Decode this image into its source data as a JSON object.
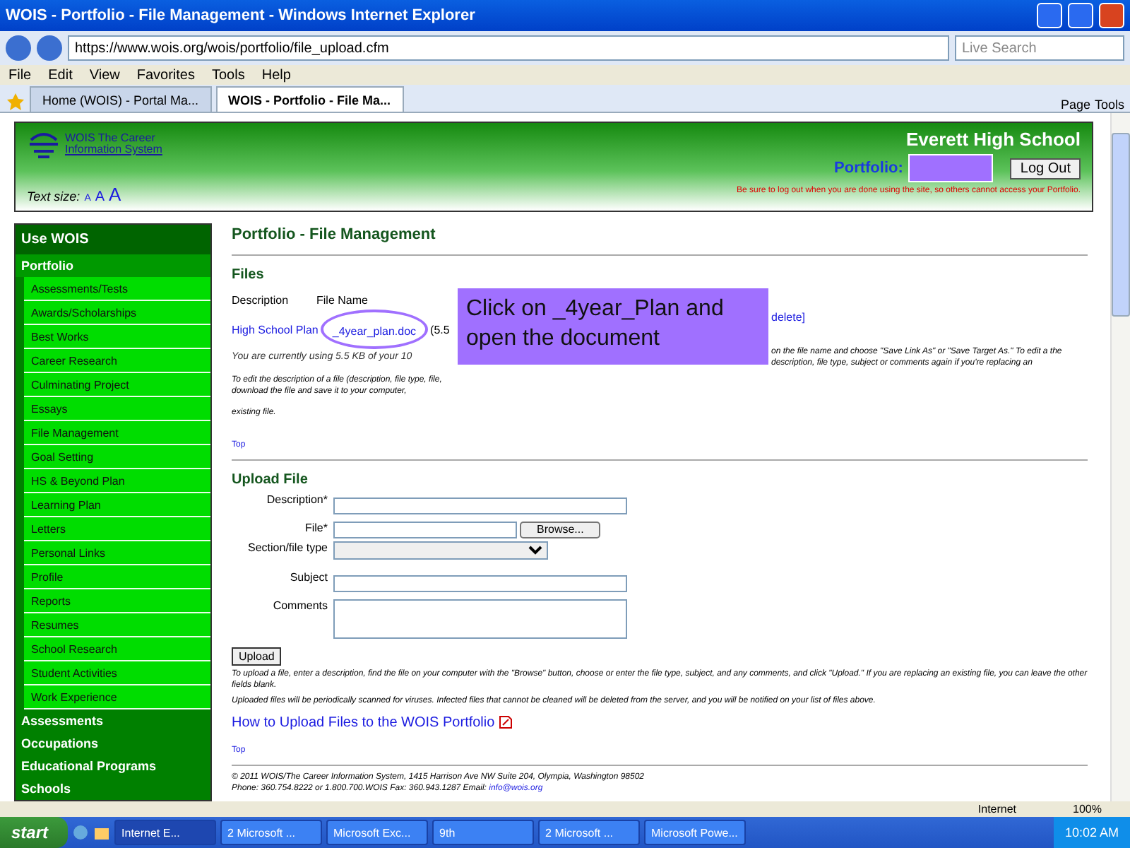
{
  "window": {
    "title": "WOIS - Portfolio - File Management - Windows Internet Explorer"
  },
  "browser": {
    "url": "https://www.wois.org/wois/portfolio/file_upload.cfm",
    "search_placeholder": "Live Search",
    "menu": [
      "File",
      "Edit",
      "View",
      "Favorites",
      "Tools",
      "Help"
    ],
    "tabs": [
      {
        "label": "Home (WOIS) - Portal Ma...",
        "selected": false
      },
      {
        "label": "WOIS - Portfolio - File Ma...",
        "selected": true
      }
    ],
    "tools": [
      "Page",
      "Tools"
    ]
  },
  "header": {
    "logo_line1": "WOIS The Career",
    "logo_line2": "Information System",
    "text_size_label": "Text size:",
    "text_sizes": [
      "A",
      "A",
      "A"
    ],
    "school": "Everett High School",
    "portfolio_label": "Portfolio:",
    "logout": "Log Out",
    "warning": "Be sure to log out when you are done using the site, so others cannot access your Portfolio."
  },
  "sidebar": {
    "heading": "Use WOIS",
    "section": "Portfolio",
    "subitems": [
      "Assessments/Tests",
      "Awards/Scholarships",
      "Best Works",
      "Career Research",
      "Culminating Project",
      "Essays",
      "File Management",
      "Goal Setting",
      "HS & Beyond Plan",
      "Learning Plan",
      "Letters",
      "Personal Links",
      "Profile",
      "Reports",
      "Resumes",
      "School Research",
      "Student Activities",
      "Work Experience"
    ],
    "items": [
      "Assessments",
      "Occupations",
      "Educational Programs",
      "Schools"
    ]
  },
  "main": {
    "title": "Portfolio - File Management",
    "files_heading": "Files",
    "columns": [
      "Description",
      "File Name"
    ],
    "row": {
      "description": "High School Plan",
      "file": "_4year_plan.doc",
      "size": "(5.5",
      "action": "delete]"
    },
    "usage": "You are currently using 5.5 KB of your 10",
    "edit_help_left": "To edit the description of a file (description, file type, file, download the file and save it to your computer,",
    "edit_help_end": "existing file.",
    "edit_help_right": "on the file name and choose \"Save Link As\" or \"Save Target As.\" To edit a the description, file type, subject or comments again if you're replacing an",
    "top1": "Top",
    "callout": "Click on _4year_Plan and open the document",
    "upload_heading": "Upload File",
    "fields": [
      {
        "label": "Description*",
        "kind": "text"
      },
      {
        "label": "File*",
        "kind": "file",
        "button": "Browse..."
      },
      {
        "label": "Section/file type",
        "kind": "select"
      },
      {
        "label": "Subject",
        "kind": "text"
      },
      {
        "label": "Comments",
        "kind": "textarea"
      }
    ],
    "upload_button": "Upload",
    "upload_help": "To upload a file, enter a description, find the file on your computer with the \"Browse\" button, choose or enter the file type, subject, and any comments, and click \"Upload.\" If you are replacing an existing file, you can leave the other fields blank.",
    "scan_note": "Uploaded files will be periodically scanned for viruses. Infected files that cannot be cleaned will be deleted from the server, and you will be notified on your list of files above.",
    "howto_link": "How to Upload Files to the WOIS Portfolio",
    "top2": "Top",
    "footer1": "© 2011 WOIS/The Career Information System, 1415 Harrison Ave NW Suite 204, Olympia, Washington 98502",
    "footer2": "Phone: 360.754.8222 or 1.800.700.WOIS Fax: 360.943.1287 Email: ",
    "footer_email": "info@wois.org"
  },
  "status": {
    "zone": "Internet",
    "zoom": "100%"
  },
  "taskbar": {
    "start": "start",
    "tasks": [
      {
        "label": "Internet E...",
        "selected": true
      },
      {
        "label": "2 Microsoft ...",
        "selected": false
      },
      {
        "label": "Microsoft Exc...",
        "selected": false
      },
      {
        "label": "9th",
        "selected": false
      },
      {
        "label": "2 Microsoft ...",
        "selected": false
      },
      {
        "label": "Microsoft Powe...",
        "selected": false
      }
    ],
    "clock": "10:02 AM"
  }
}
